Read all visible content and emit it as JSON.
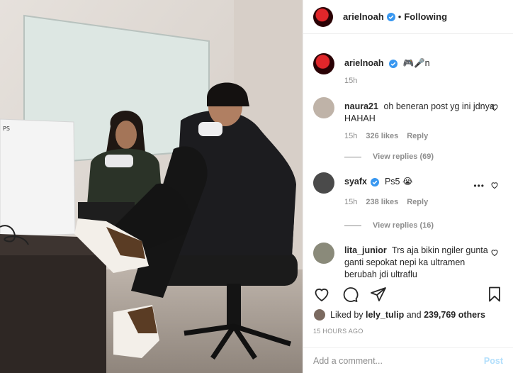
{
  "header": {
    "username": "arielnoah",
    "separator": "•",
    "follow_status": "Following"
  },
  "caption": {
    "username": "arielnoah",
    "text": "🎮🎤n",
    "time": "15h"
  },
  "comments": [
    {
      "username": "naura21",
      "text": "oh beneran post yg ini jdnya HAHAH",
      "time": "15h",
      "likes": "326 likes",
      "reply": "Reply",
      "view_replies": "View replies (69)",
      "avatar_color": "#bfb3a8"
    },
    {
      "username": "syafx",
      "text": "Ps5 😭",
      "time": "15h",
      "likes": "238 likes",
      "reply": "Reply",
      "more": "•••",
      "view_replies": "View replies (16)",
      "avatar_color": "#4a4a4a"
    },
    {
      "username": "lita_junior",
      "text": "Trs aja bikin ngiler gunta ganti sepokat nepi ka ultramen berubah jdi ultraflu",
      "avatar_color": "#8a8a7a"
    }
  ],
  "likes": {
    "prefix": "Liked by",
    "user": "lely_tulip",
    "connector": "and",
    "count": "239,769 others"
  },
  "timestamp": "15 HOURS AGO",
  "add_comment": {
    "placeholder": "Add a comment...",
    "post_label": "Post"
  },
  "colors": {
    "verified": "#3897f0",
    "post_disabled": "#b2dffc",
    "meta": "#8e8e8e"
  },
  "icons": [
    "heart-icon",
    "comment-icon",
    "share-icon",
    "bookmark-icon",
    "verified-icon",
    "ellipsis-icon"
  ]
}
